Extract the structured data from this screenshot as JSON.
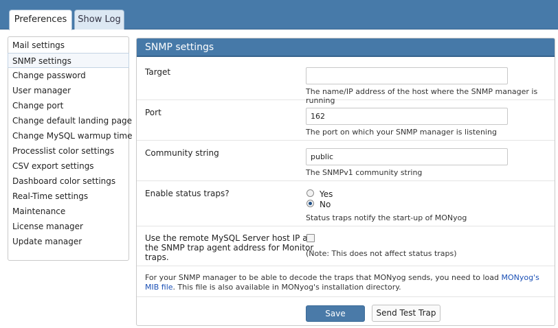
{
  "tabs": [
    {
      "label": "Preferences",
      "active": true
    },
    {
      "label": "Show Log",
      "active": false
    }
  ],
  "sidebar": {
    "selected": "SNMP settings",
    "items": [
      {
        "label": "Mail settings"
      },
      {
        "label": "SNMP settings"
      },
      {
        "label": "Change password"
      },
      {
        "label": "User manager"
      },
      {
        "label": "Change port"
      },
      {
        "label": "Change default landing page"
      },
      {
        "label": "Change MySQL warmup time"
      },
      {
        "label": "Processlist color settings"
      },
      {
        "label": "CSV export settings"
      },
      {
        "label": "Dashboard color settings"
      },
      {
        "label": "Real-Time settings"
      },
      {
        "label": "Maintenance"
      },
      {
        "label": "License manager"
      },
      {
        "label": "Update manager"
      }
    ]
  },
  "panel": {
    "title": "SNMP settings",
    "target": {
      "label": "Target",
      "value": "",
      "help": "The name/IP address of the host where the SNMP manager is running"
    },
    "port": {
      "label": "Port",
      "value": "162",
      "help": "The port on which your SNMP manager is listening"
    },
    "community": {
      "label": "Community string",
      "value": "public",
      "help": "The SNMPv1 community string"
    },
    "status_traps": {
      "label": "Enable status traps?",
      "options": [
        {
          "label": "Yes",
          "checked": false
        },
        {
          "label": "No",
          "checked": true
        }
      ],
      "help": "Status traps notify the start-up of MONyog"
    },
    "remote_host": {
      "label_line1": "Use the remote MySQL Server host IP as",
      "label_line2": "the SNMP trap agent address for Monitor",
      "label_line3": "traps.",
      "checked": false,
      "note": "(Note: This does not affect status traps)"
    },
    "info": {
      "before_link": "For your SNMP manager to be able to decode the traps that MONyog sends, you need to load ",
      "link": "MONyog's MIB file",
      "after_link": ". This file is also available in MONyog's installation directory."
    },
    "buttons": {
      "save": "Save",
      "test": "Send Test Trap"
    }
  },
  "colors": {
    "header_blue": "#477aa9",
    "button_blue": "#4a7aa8",
    "link_blue": "#1a4fb5"
  }
}
